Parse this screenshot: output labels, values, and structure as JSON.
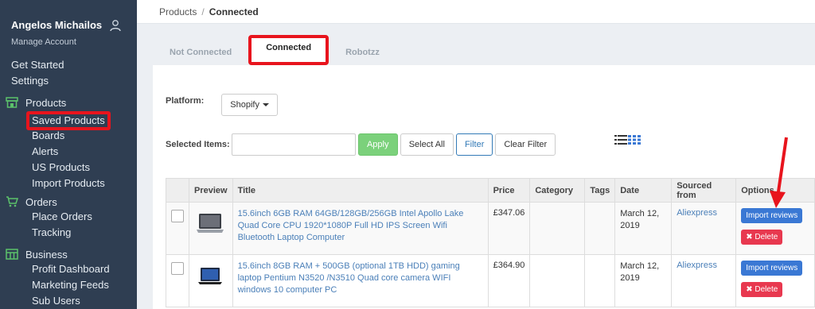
{
  "sidebar": {
    "user_name": "Angelos Michailos",
    "manage_account": "Manage Account",
    "top_items": [
      "Get Started",
      "Settings"
    ],
    "sections": [
      {
        "label": "Products",
        "icon": "store-icon",
        "items": [
          "Saved Products",
          "Boards",
          "Alerts",
          "US Products",
          "Import Products"
        ]
      },
      {
        "label": "Orders",
        "icon": "cart-icon",
        "items": [
          "Place Orders",
          "Tracking"
        ]
      },
      {
        "label": "Business",
        "icon": "grid-icon",
        "items": [
          "Profit Dashboard",
          "Marketing Feeds",
          "Sub Users"
        ]
      }
    ]
  },
  "breadcrumb": {
    "root": "Products",
    "separator": "/",
    "current": "Connected"
  },
  "tabs": [
    "Not Connected",
    "Connected",
    "Robotzz"
  ],
  "platform": {
    "label": "Platform:",
    "value": "Shopify"
  },
  "selected_items": {
    "label": "Selected Items:",
    "apply": "Apply",
    "select_all": "Select All",
    "filter": "Filter",
    "clear_filter": "Clear Filter"
  },
  "table": {
    "headers": [
      "Preview",
      "Title",
      "Price",
      "Category",
      "Tags",
      "Date",
      "Sourced from",
      "Options"
    ],
    "rows": [
      {
        "title": "15.6inch 6GB RAM 64GB/128GB/256GB Intel Apollo Lake Quad Core CPU 1920*1080P Full HD IPS Screen Wifi Bluetooth Laptop Computer",
        "price": "£347.06",
        "category": "",
        "tags": "",
        "date": "March 12, 2019",
        "source": "Aliexpress",
        "import_label": "Import reviews",
        "delete_label": "Delete"
      },
      {
        "title": "15.6inch 8GB RAM + 500GB (optional 1TB HDD) gaming laptop Pentium N3520 /N3510 Quad core camera WIFI windows 10 computer PC",
        "price": "£364.90",
        "category": "",
        "tags": "",
        "date": "March 12, 2019",
        "source": "Aliexpress",
        "import_label": "Import reviews",
        "delete_label": "Delete"
      }
    ]
  },
  "colors": {
    "sidebar_bg": "#2f3e52",
    "highlight": "#e8141d",
    "apply_green": "#7bd17b",
    "import_blue": "#3a78d4",
    "delete_red": "#e8384f"
  }
}
